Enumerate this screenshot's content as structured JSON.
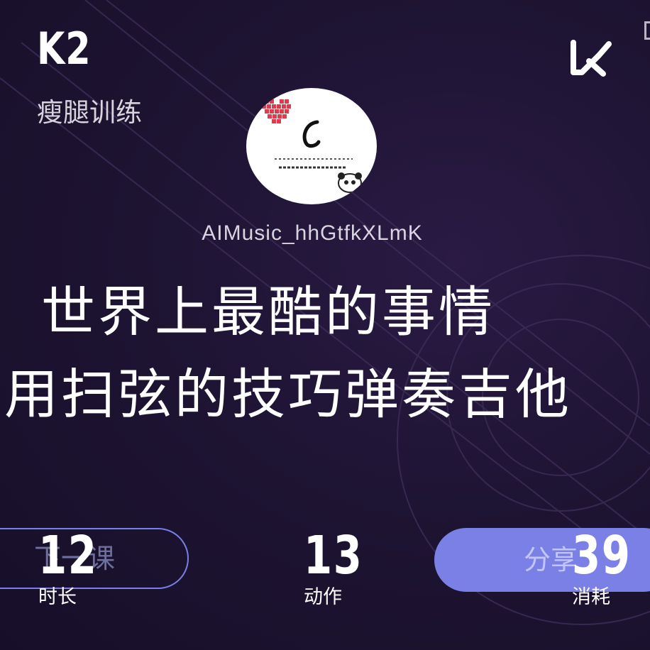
{
  "header": {
    "level": "K2",
    "course_name": "瘦腿训练"
  },
  "icons": {
    "logo": "keep-k-logo",
    "avatar": "user-avatar"
  },
  "profile": {
    "username": "AIMusic_hhGtfkXLmK"
  },
  "lyrics": {
    "line1": "世界上最酷的事情",
    "line2": "用扫弦的技巧弹奏吉他"
  },
  "buttons": {
    "next_label": "下一课",
    "share_label": "分享"
  },
  "stats": [
    {
      "value": "12",
      "label": "时长"
    },
    {
      "value": "13",
      "label": "动作"
    },
    {
      "value": "39",
      "label": "消耗"
    }
  ],
  "colors": {
    "background": "#1b1230",
    "accent": "#7b80e6",
    "text": "#ffffff"
  }
}
